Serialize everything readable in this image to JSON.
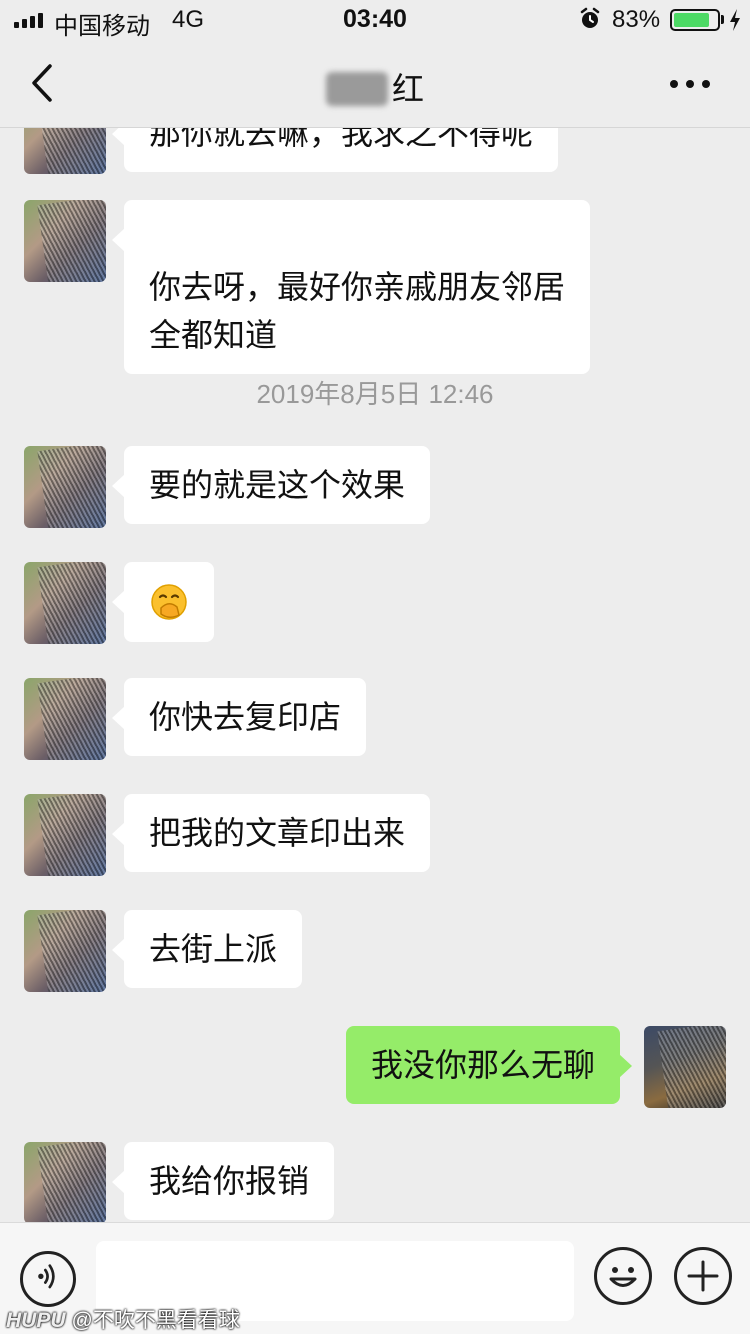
{
  "status_bar": {
    "carrier": "中国移动",
    "network": "4G",
    "time": "03:40",
    "battery_percent": "83%",
    "battery_level": 0.83
  },
  "nav": {
    "title_visible": "红",
    "back_icon": "chevron-left-icon",
    "more_icon": "ellipsis-icon"
  },
  "messages": [
    {
      "side": "in",
      "text": "那你就去嘛，我求之不得呢"
    },
    {
      "side": "in",
      "text": "你去呀，最好你亲戚朋友邻居\n全都知道"
    },
    {
      "type": "timestamp",
      "text": "2019年8月5日 12:46"
    },
    {
      "side": "in",
      "text": "要的就是这个效果"
    },
    {
      "side": "in",
      "emoji": "hand-over-mouth-face-icon",
      "glyph": "🤭"
    },
    {
      "side": "in",
      "text": "你快去复印店"
    },
    {
      "side": "in",
      "text": "把我的文章印出来"
    },
    {
      "side": "in",
      "text": "去街上派"
    },
    {
      "side": "out",
      "text": "我没你那么无聊"
    },
    {
      "side": "in",
      "text": "我给你报销"
    }
  ],
  "input_bar": {
    "input_value": "",
    "voice_icon": "voice-icon",
    "emoji_icon": "smiley-icon",
    "add_icon": "plus-icon"
  },
  "watermark": {
    "brand": "HUPU",
    "handle": "@不吹不黑看看球"
  },
  "colors": {
    "background": "#ededed",
    "incoming_bubble": "#ffffff",
    "outgoing_bubble": "#95ec69",
    "battery": "#4cd964"
  }
}
